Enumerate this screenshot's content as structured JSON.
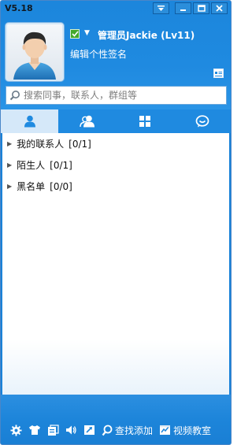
{
  "app": {
    "version": "V5.18"
  },
  "window_controls": [
    "skin-menu-icon",
    "minimize-icon",
    "maximize-icon",
    "close-icon"
  ],
  "profile": {
    "display_name": "管理员Jackie (Lv11)",
    "signature": "编辑个性签名",
    "status": "online"
  },
  "search": {
    "placeholder": "搜索同事，联系人，群组等"
  },
  "tabs": [
    {
      "id": "contacts",
      "icon": "person-icon",
      "active": true
    },
    {
      "id": "groups",
      "icon": "group-icon",
      "active": false
    },
    {
      "id": "apps",
      "icon": "apps-grid-icon",
      "active": false
    },
    {
      "id": "recent",
      "icon": "chat-bubble-icon",
      "active": false
    }
  ],
  "contact_groups": [
    {
      "name": "我的联系人",
      "count": "[0/1]"
    },
    {
      "name": "陌生人",
      "count": "[0/1]"
    },
    {
      "name": "黑名单",
      "count": "[0/0]"
    }
  ],
  "toolbar": {
    "find_add_label": "查找添加",
    "video_class_label": "视频教室"
  },
  "colors": {
    "accent": "#1a82d8",
    "active_tab": "#d5e8f9",
    "status_online": "#43a82b"
  }
}
